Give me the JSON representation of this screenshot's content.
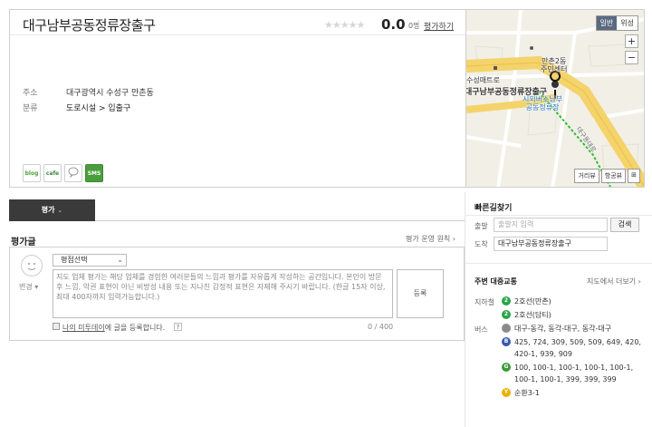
{
  "place": {
    "title": "대구남부공동정류장출구",
    "stars": "★★★★★",
    "rating": "0.0",
    "rating_count": "0명",
    "write_review_link": "평가하기",
    "address_label": "주소",
    "address": "대구광역시 수성구 만촌동",
    "category_label": "분류",
    "category": "도로시설 > 입출구",
    "share": [
      "blog",
      "cafe",
      "",
      "SMS"
    ]
  },
  "map": {
    "types": [
      "일반",
      "위성"
    ],
    "zoom_in": "+",
    "zoom_out": "−",
    "labels": {
      "district": "만촌2동\n주민센터",
      "store": "수성매트로",
      "place_name": "대구남부공동정류장출구",
      "terminal": "시외버스남부\n공동정류장",
      "road": "대구동대로"
    },
    "tools": [
      "거리뷰",
      "항공뷰",
      "⊞"
    ]
  },
  "review": {
    "tab": "평가",
    "heading": "평가글",
    "policy_link": "평가 운영 원칙 ›",
    "mood_select": "변경",
    "rating_select": "평점선택",
    "textarea_placeholder": "지도 업체 평가는 해당 업체를 경험한 여러분들의 느낌과 평가를 자유롭게 작성하는 공간입니다. 본인이 방문 후 느낌, 악권 표현이 아닌 비방성 내용 또는 지나친 감정적 표현은 자제해 주시기 바랍니다. (한글 15자 이상, 최대 400자까지 입력가능합니다.)",
    "register_button": "등록",
    "mytown_link": "나의 미투데이",
    "mytown_suffix": "에 글을 등록합니다.",
    "help_icon": "?",
    "char_count": "0 / 400"
  },
  "route": {
    "heading": "빠른길찾기",
    "start_label": "출발",
    "start_placeholder": "출발지 입력",
    "search_button": "검색",
    "end_label": "도착",
    "end_value": "대구남부공동정류장출구"
  },
  "transit": {
    "heading": "주변 대중교통",
    "more_link": "지도에서 더보기 ›",
    "subway_label": "지하철",
    "subway": [
      {
        "icon": "2",
        "text": "2호선(만촌)"
      },
      {
        "icon": "2",
        "text": "2호선(담티)"
      }
    ],
    "bus_label": "버스",
    "bus": [
      {
        "icon": "",
        "text": "대구-동각, 동각-대구, 동각-대구"
      },
      {
        "icon": "B",
        "text": "425, 724, 309, 509, 509, 649, 420, 420-1, 939, 909"
      },
      {
        "icon": "G",
        "text": "100, 100-1, 100-1, 100-1, 100-1, 100-1, 100-1, 399, 399, 399"
      },
      {
        "icon": "Y",
        "text": "순환3-1"
      }
    ]
  },
  "colors": {
    "dark_tab": "#3a3a3a",
    "subway_green": "#2aa548",
    "bus_blue": "#355ab0",
    "bus_green": "#3a9a3a",
    "bus_yellow": "#e8b200",
    "map_route": "#2fbf3a"
  }
}
